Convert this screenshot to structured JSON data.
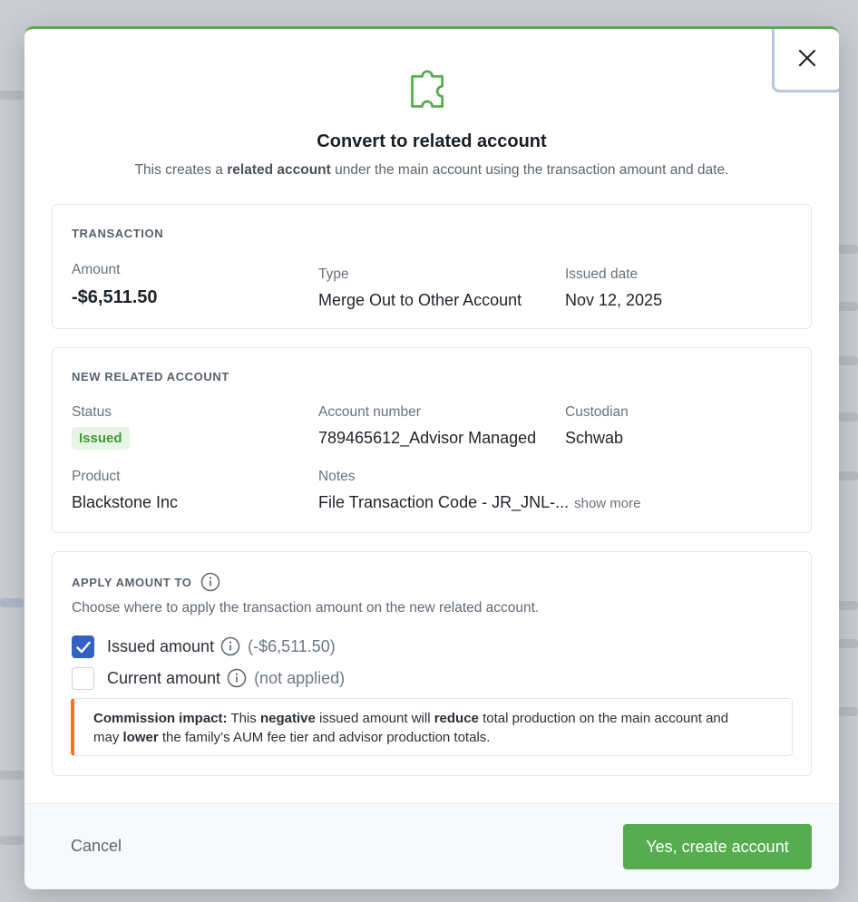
{
  "modal": {
    "title": "Convert to related account",
    "subtitle_pre": "This creates a ",
    "subtitle_bold": "related account",
    "subtitle_post": " under the main account using the transaction amount and date.",
    "header_icon": "puzzle-piece-icon",
    "accent_color": "#55ad4f"
  },
  "transaction": {
    "section_label": "TRANSACTION",
    "amount_label": "Amount",
    "amount_value": "-$6,511.50",
    "type_label": "Type",
    "type_value": "Merge Out to Other Account",
    "issued_date_label": "Issued date",
    "issued_date_value": "Nov 12, 2025"
  },
  "new_account": {
    "section_label": "NEW RELATED ACCOUNT",
    "status_label": "Status",
    "status_value": "Issued",
    "account_number_label": "Account number",
    "account_number_value": "789465612_Advisor Managed",
    "custodian_label": "Custodian",
    "custodian_value": "Schwab",
    "product_label": "Product",
    "product_value": "Blackstone Inc",
    "notes_label": "Notes",
    "notes_value": "File Transaction Code - JR_JNL-...",
    "show_more": "show more"
  },
  "apply": {
    "section_label": "APPLY AMOUNT TO",
    "description": "Choose where to apply the transaction amount on the new related account.",
    "issued_label": "Issued amount",
    "issued_note": "(-$6,511.50)",
    "issued_checked": true,
    "current_label": "Current amount",
    "current_note": "(not applied)",
    "current_checked": false,
    "impact": {
      "lead": "Commission impact:",
      "t1": " This ",
      "b1": "negative",
      "t2": " issued amount will ",
      "b2": "reduce",
      "t3": " total production on the main account and",
      "t4": "may ",
      "b3": "lower",
      "t5": " the family’s AUM fee tier and advisor production totals."
    }
  },
  "footer": {
    "cancel_label": "Cancel",
    "confirm_label": "Yes, create account"
  }
}
